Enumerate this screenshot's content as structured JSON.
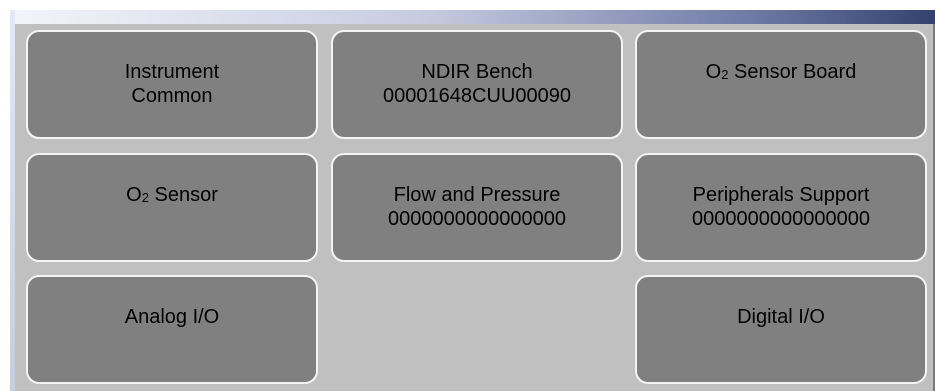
{
  "buttons": {
    "instrument_common": {
      "line1": "Instrument",
      "line2": "Common"
    },
    "ndir_bench": {
      "line1": "NDIR Bench",
      "line2": "00001648CUU00090"
    },
    "o2_sensor_board": {
      "prefix": "O",
      "subscript": "2",
      "suffix": " Sensor Board"
    },
    "o2_sensor": {
      "prefix": "O",
      "subscript": "2",
      "suffix": " Sensor"
    },
    "flow_and_pressure": {
      "line1": "Flow and Pressure",
      "line2": "0000000000000000"
    },
    "peripherals_support": {
      "line1": "Peripherals Support",
      "line2": "0000000000000000"
    },
    "analog_io": {
      "label": "Analog I/O"
    },
    "digital_io": {
      "label": "Digital I/O"
    }
  },
  "colors": {
    "panel_background": "#c0c0c0",
    "button_fill": "#808080",
    "button_border": "#f4f4f4",
    "header_gradient_end": "#34416e"
  }
}
